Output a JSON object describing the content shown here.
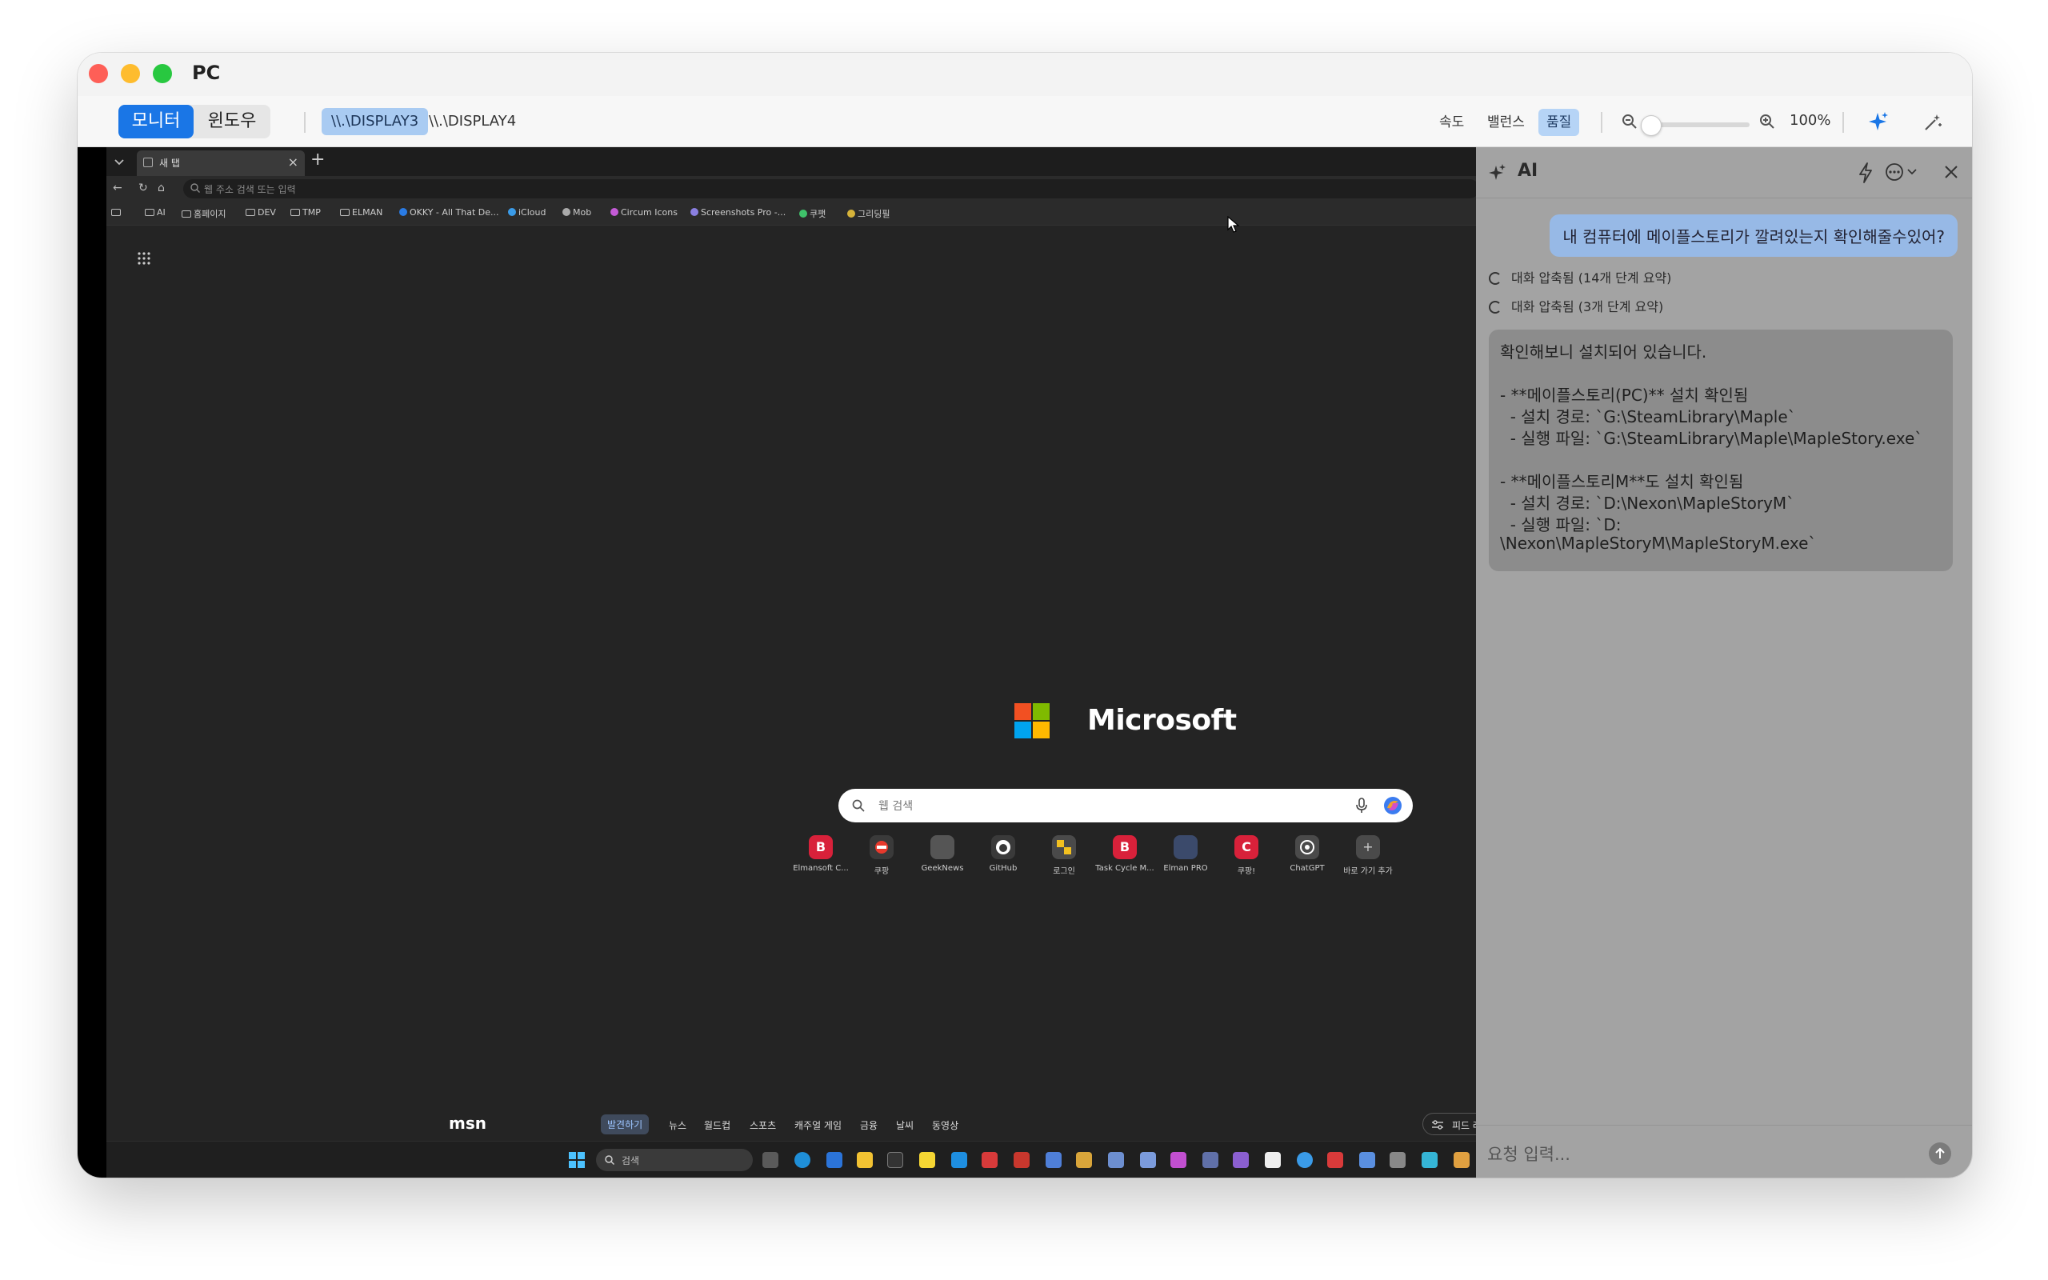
{
  "window": {
    "title": "PC"
  },
  "toolbar": {
    "mode_monitor": "모니터",
    "mode_window": "윈도우",
    "displays": [
      "\\\\.\\DISPLAY3",
      "\\\\.\\DISPLAY4"
    ],
    "quality_speed": "속도",
    "quality_balance": "밸런스",
    "quality_quality": "품질",
    "zoom": "100%"
  },
  "remote": {
    "tab_title": "새 탭",
    "address_placeholder": "웹 주소 검색 또는 입력",
    "favorites": [
      "AI",
      "홈페이지",
      "DEV",
      "TMP",
      "ELMAN",
      "OKKY - All That De...",
      "iCloud",
      "Mob",
      "Circum Icons",
      "Screenshots Pro -...",
      "쿠팻",
      "그리딩필"
    ],
    "logo_text": "Microsoft",
    "search_placeholder": "웹 검색",
    "quick_links": [
      {
        "label": "Elmansoft C...",
        "letter": "B",
        "color": "#d8213a"
      },
      {
        "label": "쿠팡",
        "letter": "",
        "color": "#e8392c"
      },
      {
        "label": "GeekNews",
        "letter": "",
        "color": "#555555"
      },
      {
        "label": "GitHub",
        "letter": "",
        "color": "#3a3a3a"
      },
      {
        "label": "로그인",
        "letter": "",
        "color": "#4a4a4a"
      },
      {
        "label": "Task Cycle M...",
        "letter": "B",
        "color": "#d8213a"
      },
      {
        "label": "Elman PRO",
        "letter": "",
        "color": "#3b4a6b"
      },
      {
        "label": "쿠팡!",
        "letter": "C",
        "color": "#d8213a"
      },
      {
        "label": "ChatGPT",
        "letter": "",
        "color": "#4a4a4a"
      },
      {
        "label": "바로 가기 추가",
        "letter": "+",
        "color": "#4a4a4a"
      }
    ],
    "msn": {
      "logo": "msn",
      "items": [
        "발견하기",
        "뉴스",
        "월드컵",
        "스포츠",
        "캐주얼 게임",
        "금융",
        "날씨",
        "동영상"
      ],
      "feed_button": "피드 레이아"
    },
    "taskbar_search": "검색"
  },
  "ai": {
    "title": "AI",
    "user_message": "내 컴퓨터에 메이플스토리가 깔려있는지 확인해줄수있어?",
    "summaries": [
      "대화 압축됨 (14개 단계 요약)",
      "대화 압축됨 (3개 단계 요약)"
    ],
    "answer_lines": [
      "확인해보니 설치되어 있습니다.",
      "",
      "- **메이플스토리(PC)** 설치 확인됨",
      "  - 설치 경로: `G:\\SteamLibrary\\Maple`",
      "  - 실행 파일: `G:\\SteamLibrary\\Maple\\MapleStory.exe`",
      "",
      "- **메이플스토리M**도 설치 확인됨",
      "  - 설치 경로: `D:\\Nexon\\MapleStoryM`",
      "  - 실행 파일: `D:",
      "\\Nexon\\MapleStoryM\\MapleStoryM.exe`"
    ],
    "input_placeholder": "요청 입력..."
  }
}
